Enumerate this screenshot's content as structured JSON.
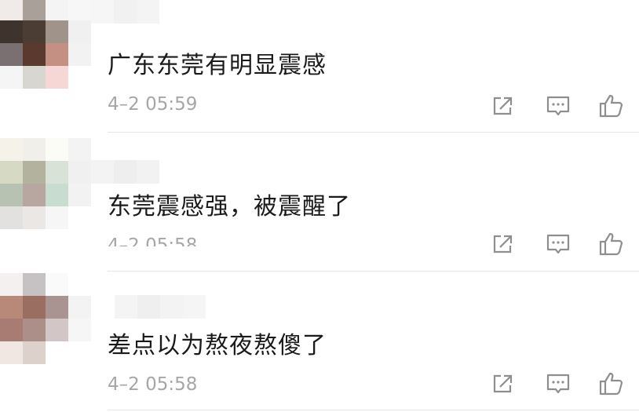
{
  "comments": [
    {
      "text": "广东东莞有明显震感",
      "time": "4–2 05:59",
      "avatar_colors": [
        "#f0ebe8",
        "#a9a09a",
        "#f4f4f4",
        "#f7f7f7",
        "#3e332d",
        "#4b3d33",
        "#a0948a",
        "#f0f0f0",
        "#7a7072",
        "#5a3a2e",
        "#c49084",
        "#f2f2f2",
        "#f5f5f5",
        "#d8d6d0",
        "#f7d7d6",
        "#ffffff"
      ]
    },
    {
      "text": "东莞震感强，被震醒了",
      "time": "4–2 05:58",
      "avatar_colors": [
        "#f5f2ea",
        "#f1efe9",
        "#fcfcf7",
        "#f3f3f3",
        "#d6d9c4",
        "#b3b29e",
        "#d8e2d6",
        "#f0f0f0",
        "#b8c2b2",
        "#b8a7a0",
        "#c8dcd0",
        "#f2f2f2",
        "#e2e1df",
        "#ebe7e5",
        "#f6f6f6",
        "#ffffff"
      ]
    },
    {
      "text": "差点以为熬夜熬傻了",
      "time": "4–2 05:58",
      "avatar_colors": [
        "#f4f0f0",
        "#c6c2c4",
        "#fafafa",
        "#ffffff",
        "#b88878",
        "#9a6e60",
        "#aa9492",
        "#f3f3f3",
        "#a87c72",
        "#ad8f8a",
        "#d2c6c6",
        "#f6f6f6",
        "#f0e7e2",
        "#ddd1cc",
        "#ffffff",
        "#ffffff"
      ]
    }
  ],
  "icons": {
    "share": "share-icon",
    "comment": "comment-icon",
    "like": "like-icon"
  },
  "colors": {
    "text": "#1a1a1a",
    "timestamp": "#a6a6a6",
    "icon": "#8e8e8e",
    "divider": "#e6e6e6"
  }
}
